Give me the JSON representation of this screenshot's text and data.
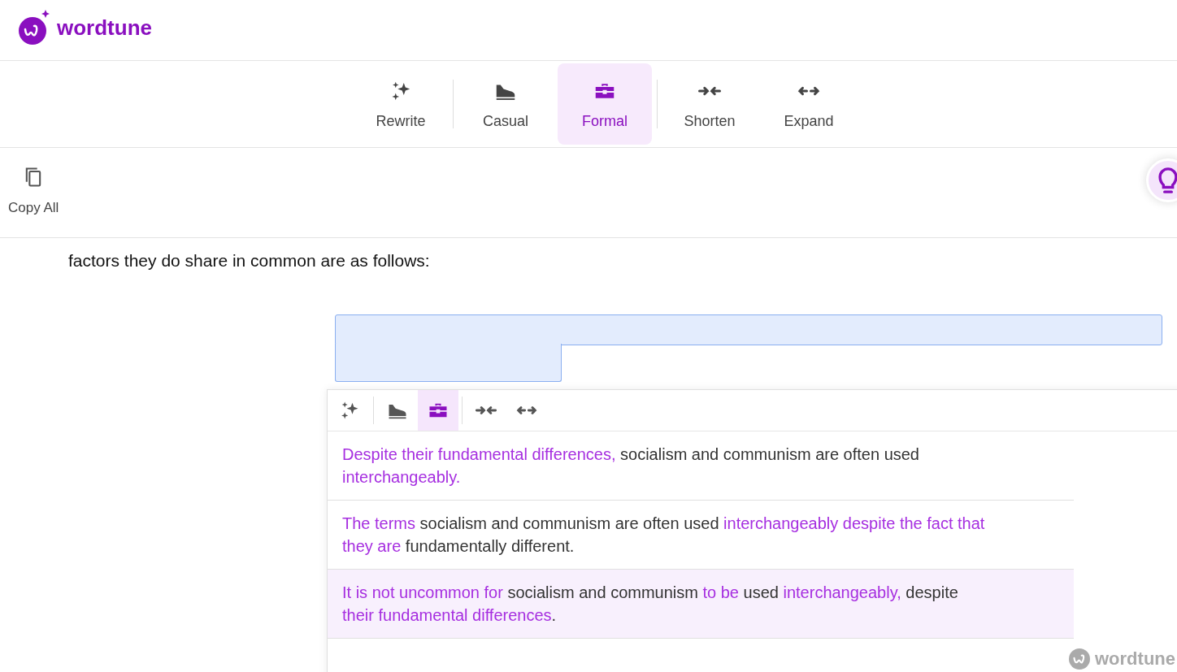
{
  "header": {
    "logo_text": "wordtune"
  },
  "toolbar": {
    "tools": [
      {
        "kind": "rewrite",
        "label": "Rewrite",
        "selected": false
      },
      {
        "kind": "casual",
        "label": "Casual",
        "selected": false
      },
      {
        "kind": "formal",
        "label": "Formal",
        "selected": true
      },
      {
        "kind": "shorten",
        "label": "Shorten",
        "selected": false
      },
      {
        "kind": "expand",
        "label": "Expand",
        "selected": false
      }
    ]
  },
  "copy_all": {
    "label": "Copy All"
  },
  "document": {
    "text": "factors they do share in common are as follows:"
  },
  "panel": {
    "modes": [
      {
        "kind": "rewrite",
        "selected": false
      },
      {
        "kind": "casual",
        "selected": false
      },
      {
        "kind": "formal",
        "selected": true
      },
      {
        "kind": "shorten",
        "selected": false
      },
      {
        "kind": "expand",
        "selected": false
      }
    ],
    "suggestions": [
      {
        "selected": false,
        "segments": [
          {
            "text": "Despite their fundamental differences,",
            "changed": true
          },
          {
            "text": " socialism and communism are often used ",
            "changed": false
          },
          {
            "text": "interchangeably.",
            "changed": true
          }
        ]
      },
      {
        "selected": false,
        "segments": [
          {
            "text": "The terms",
            "changed": true
          },
          {
            "text": " socialism and communism are often used ",
            "changed": false
          },
          {
            "text": "interchangeably despite the fact that they are",
            "changed": true
          },
          {
            "text": " fundamentally different.",
            "changed": false
          }
        ]
      },
      {
        "selected": true,
        "segments": [
          {
            "text": "It is not uncommon for",
            "changed": true
          },
          {
            "text": " socialism and communism ",
            "changed": false
          },
          {
            "text": "to be",
            "changed": true
          },
          {
            "text": " used ",
            "changed": false
          },
          {
            "text": "interchangeably,",
            "changed": true
          },
          {
            "text": " despite ",
            "changed": false
          },
          {
            "text": "their fundamental differences",
            "changed": true
          },
          {
            "text": ".",
            "changed": false
          }
        ]
      }
    ],
    "footer_logo_text": "wordtune"
  }
}
